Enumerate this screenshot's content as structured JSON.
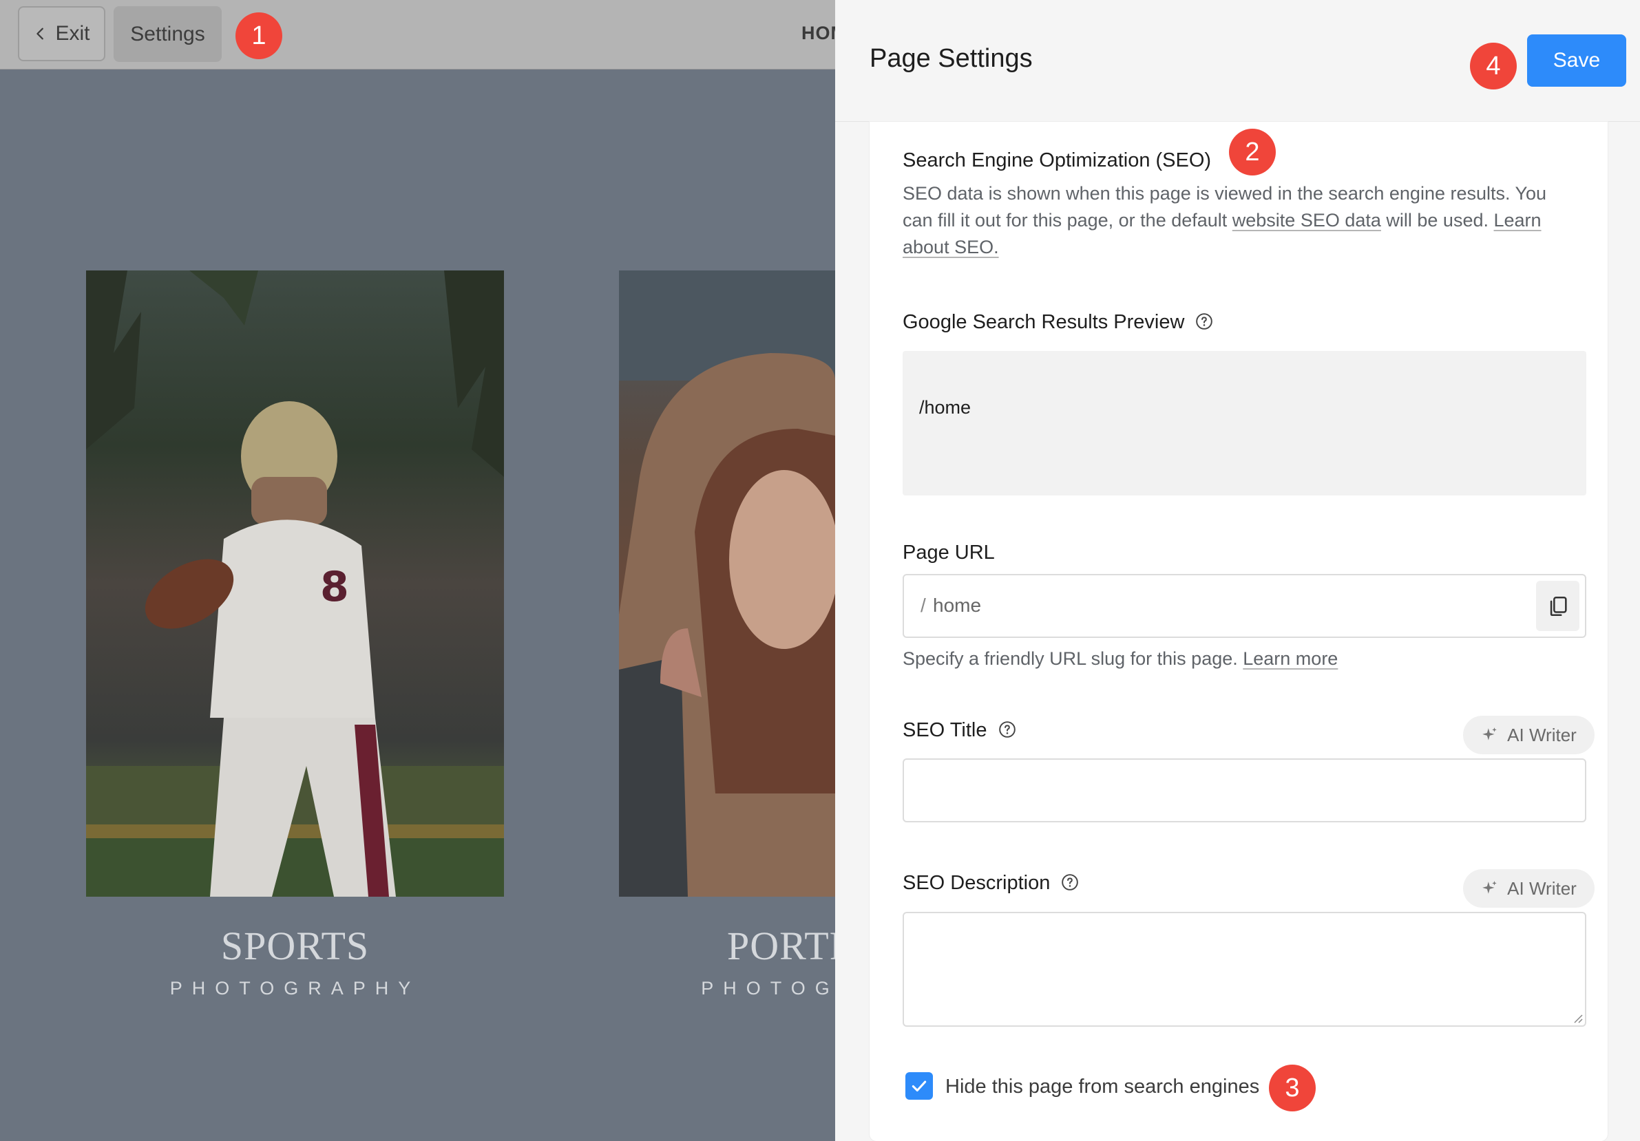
{
  "editor": {
    "exit_label": "Exit",
    "settings_label": "Settings",
    "nav_home": "HOME",
    "galleries": [
      {
        "title": "SPORTS",
        "subtitle": "PHOTOGRAPHY"
      },
      {
        "title": "PORTRAIT",
        "subtitle": "PHOTOGRAPHY"
      }
    ]
  },
  "panel": {
    "title": "Page Settings",
    "save_label": "Save",
    "seo": {
      "title": "Search Engine Optimization (SEO)",
      "desc_1": "SEO data is shown when this page is viewed in the search engine results. You can fill it out for this page, or the default ",
      "desc_link_1": "website SEO data",
      "desc_2": " will be used. ",
      "desc_link_2": "Learn about SEO."
    },
    "preview": {
      "label": "Google Search Results Preview",
      "url": "/home"
    },
    "page_url": {
      "label": "Page URL",
      "prefix": "/",
      "value": "home",
      "hint": "Specify a friendly URL slug for this page. ",
      "hint_link": "Learn more"
    },
    "seo_title": {
      "label": "SEO Title",
      "ai_label": "AI Writer",
      "value": ""
    },
    "seo_description": {
      "label": "SEO Description",
      "ai_label": "AI Writer",
      "value": ""
    },
    "hide_checkbox": {
      "label": "Hide this page from search engines",
      "checked": true
    }
  },
  "annotations": [
    "1",
    "2",
    "3",
    "4"
  ],
  "colors": {
    "accent": "#2d8bfa",
    "badge": "#f0453a",
    "overlay": "#6b7480"
  }
}
